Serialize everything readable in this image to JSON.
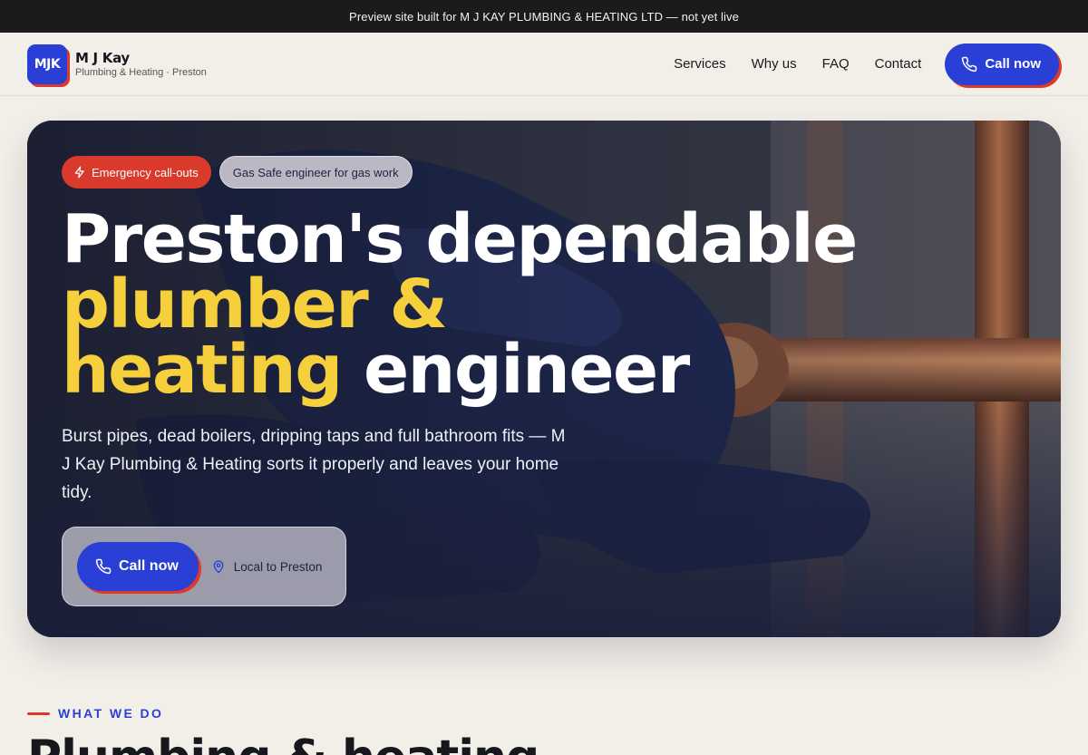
{
  "preview_bar": {
    "text": "Preview site built for M J KAY PLUMBING & HEATING LTD — not yet live"
  },
  "header": {
    "logo_text": "MJK",
    "brand_name": "M J Kay",
    "brand_sub": "Plumbing & Heating · Preston",
    "nav": [
      "Services",
      "Why us",
      "FAQ",
      "Contact"
    ],
    "cta_label": "Call now",
    "cta_icon": "phone-icon"
  },
  "hero": {
    "badges": [
      {
        "label": "Emergency call-outs",
        "icon": "lightning-icon"
      },
      {
        "label": "Gas Safe engineer for gas work"
      }
    ],
    "headline": {
      "line1": "Preston's dependable",
      "line2": "plumber &",
      "line3_highlight": "heating",
      "line3_rest": " engineer"
    },
    "lead": "Burst pipes, dead boilers, dripping taps and full bathroom fits — M J Kay Plumbing & Heating sorts it properly and leaves your home tidy.",
    "cta_label": "Call now",
    "cta_icon": "phone-icon",
    "location_label": "Local to Preston",
    "location_icon": "map-pin-icon"
  },
  "services_section": {
    "eyebrow": "WHAT WE DO",
    "title": "Plumbing & heating"
  },
  "colors": {
    "brand_blue": "#2a3fd6",
    "accent_red": "#d93a2b",
    "highlight_yellow": "#f6cf3c",
    "page_bg": "#f2efe9",
    "top_bar_bg": "#1b1b1b"
  }
}
